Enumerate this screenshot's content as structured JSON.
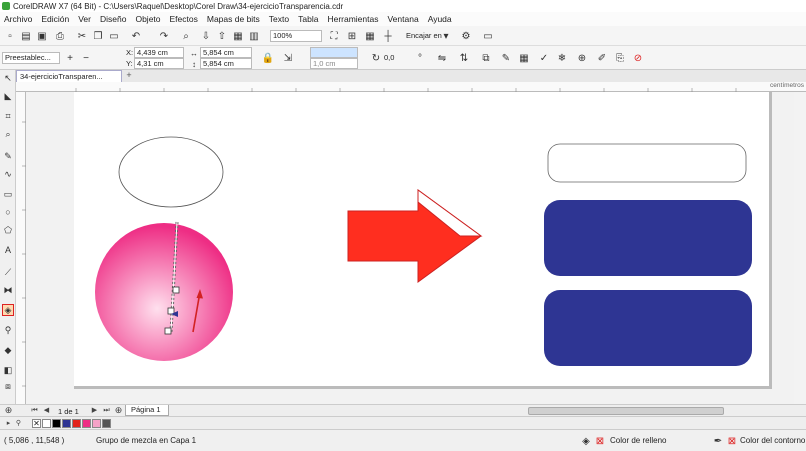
{
  "window": {
    "title": "CorelDRAW X7 (64 Bit) - C:\\Users\\Raquel\\Desktop\\Corel Draw\\34-ejercicioTransparencia.cdr"
  },
  "menu": [
    "Archivo",
    "Edición",
    "Ver",
    "Diseño",
    "Objeto",
    "Efectos",
    "Mapas de bits",
    "Texto",
    "Tabla",
    "Herramientas",
    "Ventana",
    "Ayuda"
  ],
  "toolbar": {
    "zoom": "100%",
    "snap_label": "Encajar en"
  },
  "property_bar": {
    "preset": "Preestablec...",
    "x_value": "4,439 cm",
    "y_value": "4,31 cm",
    "width_value": "5,854 cm",
    "height_value": "5,854 cm",
    "x_label": "X:",
    "y_label": "Y:",
    "angle_value": "0,0",
    "outline_value": "1,0 cm"
  },
  "document_tab": {
    "label": "34-ejercicioTransparen..."
  },
  "ruler": {
    "units": "centímetros"
  },
  "page_nav": {
    "counter": "1 de 1",
    "page_tab": "Página 1"
  },
  "status": {
    "coords": "( 5,086 , 11,548 )",
    "info": "Grupo de mezcla en Capa 1",
    "fill_label": "Color de relleno",
    "outline_label": "Color del contorno"
  },
  "colors": {
    "arrow_fill": "#ff2e1f",
    "arrow_stroke": "#cc2222",
    "sphere_center": "#ffe0ee",
    "sphere_edge": "#ee2d84",
    "bar_fill": "#2e3593",
    "highlight": "#d22222"
  },
  "palette": [
    "#ffffff",
    "#000000",
    "#2e3593",
    "#e2231a",
    "#ee2d84",
    "#f5a3c7",
    "#555555"
  ]
}
